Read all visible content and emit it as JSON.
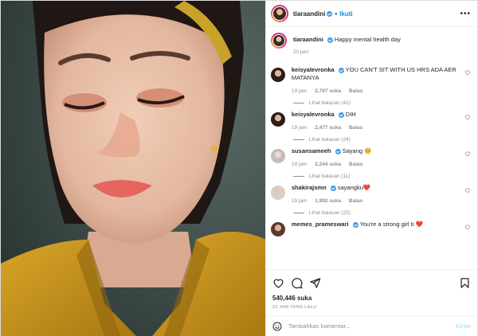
{
  "header": {
    "username": "tiaraandini",
    "separator": "•",
    "follow_label": "Ikuti",
    "more_label": "•••"
  },
  "caption": {
    "username": "tiaraandini",
    "text": "Happy mental health day",
    "time": "20 jam"
  },
  "comments": [
    {
      "username": "keisyalevronka",
      "verified": true,
      "text": "YOU CAN'T SIT WITH US HRS ADA AER MATANYA",
      "time": "19 jam",
      "likes": "2,797 suka",
      "reply": "Balas",
      "replies": "Lihat balasan (41)",
      "avatar_color": "#2b1e1a"
    },
    {
      "username": "keisyalevronka",
      "verified": true,
      "text": "DIH",
      "time": "19 jam",
      "likes": "2,477 suka",
      "reply": "Balas",
      "replies": "Lihat balasan (24)",
      "avatar_color": "#2b1e1a"
    },
    {
      "username": "susansameeh",
      "verified": true,
      "text": "Sayang 🥺",
      "time": "19 jam",
      "likes": "2,244 suka",
      "reply": "Balas",
      "replies": "Lihat balasan (11)",
      "avatar_color": "#c9c9c9"
    },
    {
      "username": "shakirajsmn",
      "verified": true,
      "text": "sayangku❤️",
      "time": "19 jam",
      "likes": "1,992 suka",
      "reply": "Balas",
      "replies": "Lihat balasan (22)",
      "avatar_color": "#d8cfc6"
    },
    {
      "username": "memes_prameswari",
      "verified": true,
      "text": "You're a strong girl ti ❤️",
      "time": "",
      "likes": "",
      "reply": "",
      "replies": "",
      "avatar_color": "#5a3a2e"
    }
  ],
  "actions": {
    "icons": [
      "heart-icon",
      "comment-icon",
      "share-icon",
      "bookmark-icon"
    ],
    "likes": "540,446 suka",
    "age": "20 JAM YANG LALU"
  },
  "composer": {
    "placeholder": "Tambahkan komentar...",
    "send_label": "Kirim"
  },
  "colors": {
    "link_blue": "#0095f6",
    "verified_blue": "#3897f0",
    "muted_text": "#8e8e8e",
    "shirt_mustard": "#c8961c"
  }
}
